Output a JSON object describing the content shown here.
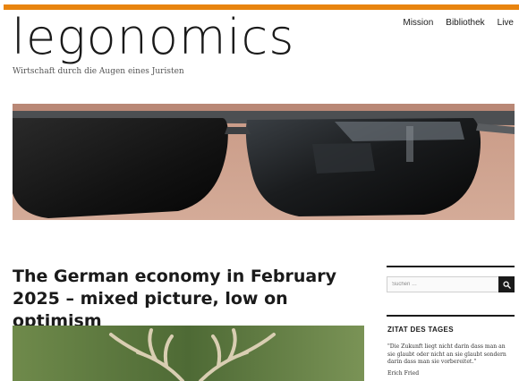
{
  "site": {
    "logo_text": "legonomics",
    "tagline": "Wirtschaft durch die Augen eines Juristen",
    "accent_color": "#e8840f"
  },
  "nav": {
    "items": [
      {
        "label": "Mission"
      },
      {
        "label": "Bibliothek"
      },
      {
        "label": "Live"
      }
    ]
  },
  "post": {
    "title": "The German economy in February 2025 – mixed picture, low on optimism"
  },
  "sidebar": {
    "search": {
      "placeholder": "Suchen …",
      "icon": "search-icon"
    },
    "quote_widget": {
      "title": "ZITAT DES TAGES",
      "quote": "\"Die Zukunft liegt nicht darin dass man an sie glaubt oder nicht an sie glaubt sondern darin dass man sie vorbereitet.\"",
      "author": "Erich Fried"
    }
  }
}
